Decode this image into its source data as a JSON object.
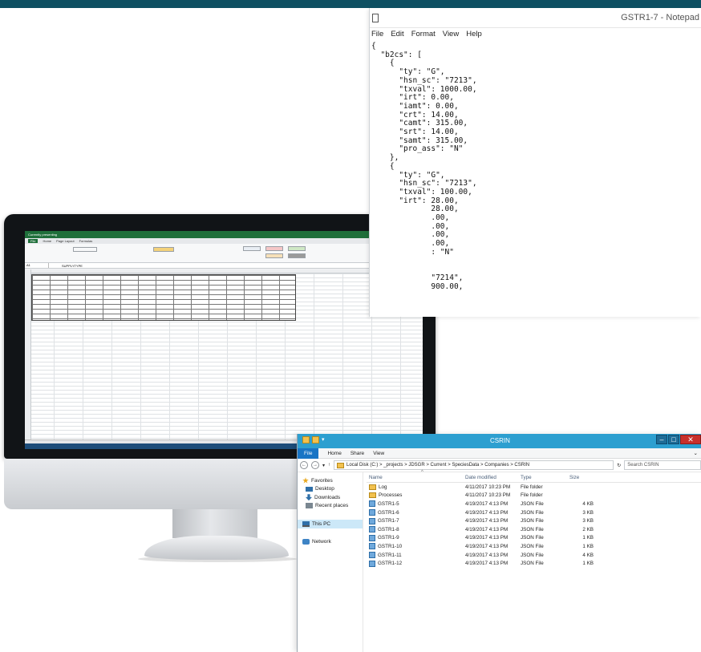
{
  "notepad": {
    "title": "GSTR1-7 - Notepad",
    "menu": [
      "File",
      "Edit",
      "Format",
      "View",
      "Help"
    ],
    "content": "{\n  \"b2cs\": [\n    {\n      \"ty\": \"G\",\n      \"hsn_sc\": \"7213\",\n      \"txval\": 1000.00,\n      \"irt\": 0.00,\n      \"iamt\": 0.00,\n      \"crt\": 14.00,\n      \"camt\": 315.00,\n      \"srt\": 14.00,\n      \"samt\": 315.00,\n      \"pro_ass\": \"N\"\n    },\n    {\n      \"ty\": \"G\",\n      \"hsn_sc\": \"7213\",\n      \"txval\": 100.00,\n      \"irt\": 28.00,\n             28.00,\n             .00,\n             .00,\n             .00,\n             .00,\n             : \"N\"\n\n\n             \"7214\",\n             900.00,"
  },
  "explorer": {
    "title": "CSRIN",
    "ribbon_tabs": [
      "File",
      "Home",
      "Share",
      "View"
    ],
    "path": "Local Disk (C:) > _projects > JDSGR > Current > SpeciesData > Companies > CSRIN",
    "search_placeholder": "Search CSRIN",
    "nav": {
      "favorites": "Favorites",
      "desktop": "Desktop",
      "downloads": "Downloads",
      "recent": "Recent places",
      "this_pc": "This PC",
      "network": "Network"
    },
    "columns": {
      "name": "Name",
      "date": "Date modified",
      "type": "Type",
      "size": "Size"
    },
    "files": [
      {
        "name": "Log",
        "date": "4/11/2017 10:23 PM",
        "type": "File folder",
        "size": "",
        "icon": "folder-icon"
      },
      {
        "name": "Processes",
        "date": "4/11/2017 10:23 PM",
        "type": "File folder",
        "size": "",
        "icon": "folder-icon"
      },
      {
        "name": "GSTR1-5",
        "date": "4/19/2017 4:13 PM",
        "type": "JSON File",
        "size": "4 KB",
        "icon": "json-icon"
      },
      {
        "name": "GSTR1-6",
        "date": "4/19/2017 4:13 PM",
        "type": "JSON File",
        "size": "3 KB",
        "icon": "json-icon"
      },
      {
        "name": "GSTR1-7",
        "date": "4/19/2017 4:13 PM",
        "type": "JSON File",
        "size": "3 KB",
        "icon": "json-icon"
      },
      {
        "name": "GSTR1-8",
        "date": "4/19/2017 4:13 PM",
        "type": "JSON File",
        "size": "2 KB",
        "icon": "json-icon"
      },
      {
        "name": "GSTR1-9",
        "date": "4/19/2017 4:13 PM",
        "type": "JSON File",
        "size": "1 KB",
        "icon": "json-icon"
      },
      {
        "name": "GSTR1-10",
        "date": "4/19/2017 4:13 PM",
        "type": "JSON File",
        "size": "1 KB",
        "icon": "json-icon"
      },
      {
        "name": "GSTR1-11",
        "date": "4/19/2017 4:13 PM",
        "type": "JSON File",
        "size": "4 KB",
        "icon": "json-icon"
      },
      {
        "name": "GSTR1-12",
        "date": "4/19/2017 4:13 PM",
        "type": "JSON File",
        "size": "1 KB",
        "icon": "json-icon"
      }
    ],
    "status_glyph": "08"
  },
  "excel": {
    "title": "Currently presenting",
    "tabs": [
      "File",
      "Home",
      "Page Layout",
      "Formulas"
    ],
    "namebox": "A1",
    "formula": "SUPPLYTYPE"
  },
  "colors": {
    "topbar": "#0e5062",
    "explorer_titlebar": "#2d9fd0",
    "excel_green": "#1f6f3a"
  }
}
